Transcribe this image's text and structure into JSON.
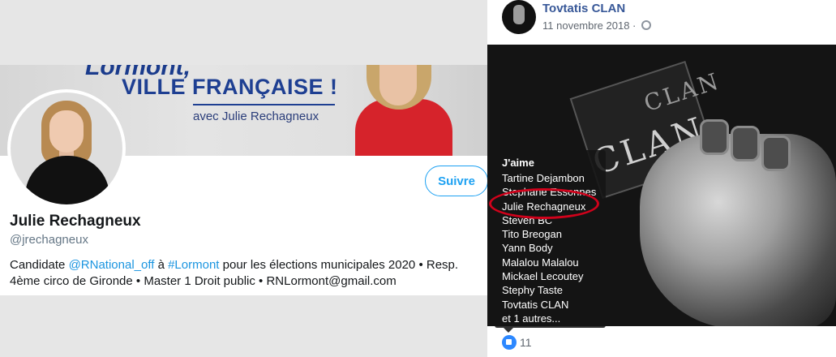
{
  "twitter": {
    "banner": {
      "top_text": "Lormont,",
      "title": "VILLE FRANÇAISE !",
      "subtitle": "avec Julie Rechagneux"
    },
    "follow_label": "Suivre",
    "name": "Julie Rechagneux",
    "handle": "@jrechagneux",
    "bio": {
      "p1": "Candidate ",
      "link1": "@RNational_off",
      "p2": " à ",
      "link2": "#Lormont",
      "p3": " pour les élections municipales 2020 • Resp. 4ème circo de Gironde • Master 1 Droit public • RNLormont@gmail.com"
    }
  },
  "facebook": {
    "page_name": "Tovtatis CLAN",
    "date": "11 novembre 2018 ·",
    "photo_text": {
      "main": "CLAN",
      "top": "CLAN"
    },
    "tooltip": {
      "title": "J'aime",
      "items": [
        "Tartine Dejambon",
        "Stephane Essonnes",
        "Julie Rechagneux",
        "Steven BC",
        "Tito Breogan",
        "Yann Body",
        "Malalou Malalou",
        "Mickael Lecoutey",
        "Stephy Taste",
        "Tovtatis CLAN",
        "et 1 autres..."
      ]
    },
    "like_count": "11"
  },
  "colors": {
    "twitter_blue": "#1da1f2",
    "fb_blue": "#385898",
    "highlight_red": "#d0021b",
    "banner_navy": "#1e3f92"
  }
}
